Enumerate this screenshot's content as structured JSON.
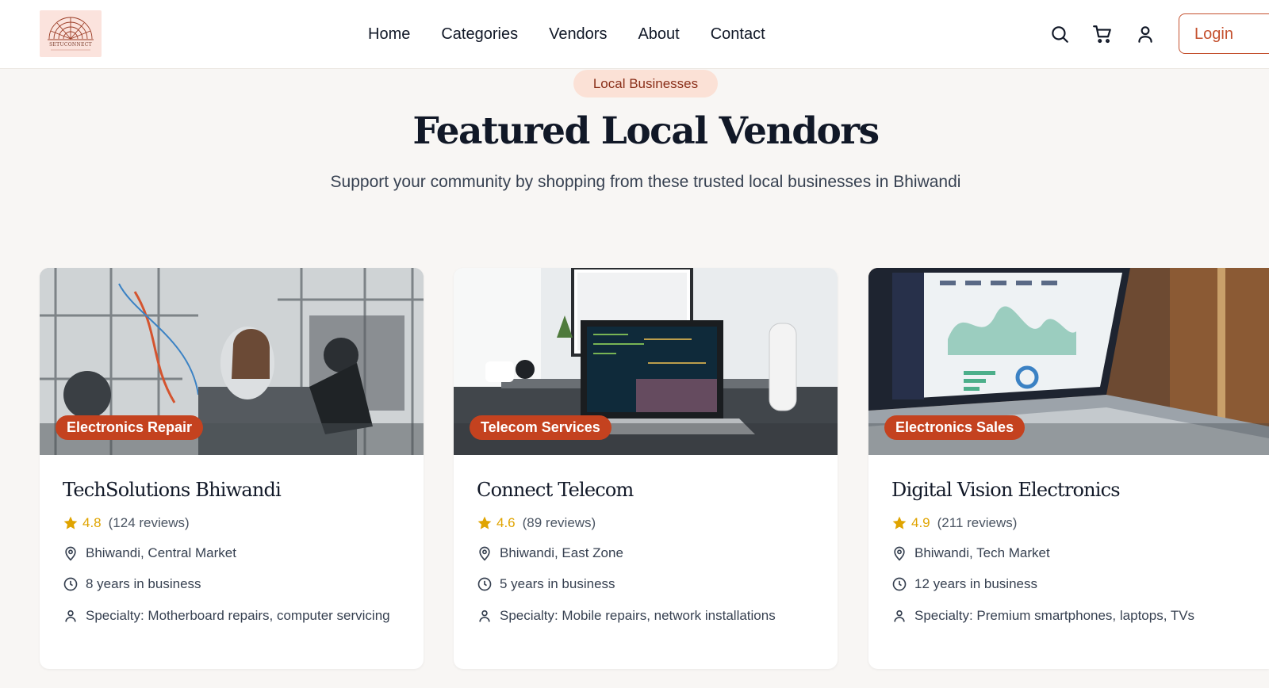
{
  "header": {
    "logo_text": "SETUCONNECT",
    "nav": [
      "Home",
      "Categories",
      "Vendors",
      "About",
      "Contact"
    ],
    "icons": [
      "search-icon",
      "cart-icon",
      "user-icon"
    ],
    "login_label": "Login"
  },
  "hero": {
    "pill": "Local Businesses",
    "title": "Featured Local Vendors",
    "subtitle": "Support your community by shopping from these trusted local businesses in Bhiwandi"
  },
  "vendors": [
    {
      "badge": "Electronics Repair",
      "name": "TechSolutions Bhiwandi",
      "rating": "4.8",
      "reviews": "(124 reviews)",
      "location": "Bhiwandi, Central Market",
      "years": "8 years in business",
      "specialty": "Specialty: Motherboard repairs, computer servicing"
    },
    {
      "badge": "Telecom Services",
      "name": "Connect Telecom",
      "rating": "4.6",
      "reviews": "(89 reviews)",
      "location": "Bhiwandi, East Zone",
      "years": "5 years in business",
      "specialty": "Specialty: Mobile repairs, network installations"
    },
    {
      "badge": "Electronics Sales",
      "name": "Digital Vision Electronics",
      "rating": "4.9",
      "reviews": "(211 reviews)",
      "location": "Bhiwandi, Tech Market",
      "years": "12 years in business",
      "specialty": "Specialty: Premium smartphones, laptops, TVs"
    }
  ],
  "colors": {
    "accent": "#c4502e",
    "badge": "#c4421f",
    "star": "#e0a400",
    "pill_bg": "#fbe1d6",
    "page_bg": "#f8f6f4"
  }
}
